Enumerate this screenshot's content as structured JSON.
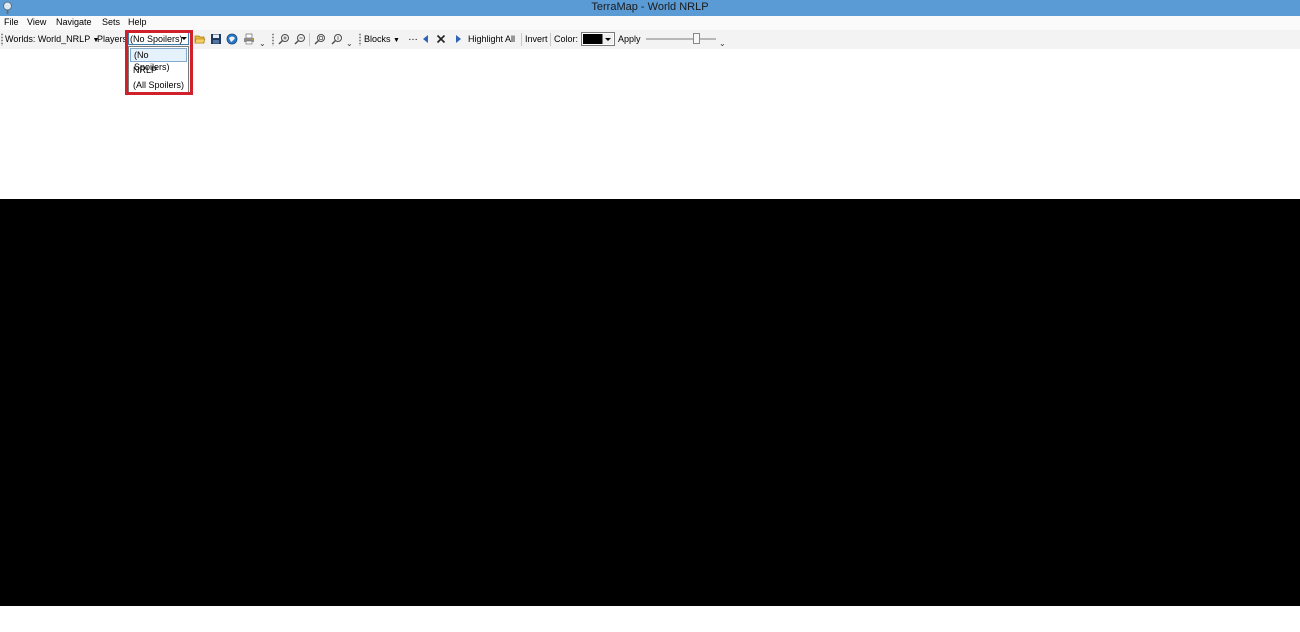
{
  "window": {
    "title": "TerraMap - World NRLP"
  },
  "menu": [
    "File",
    "View",
    "Navigate",
    "Sets",
    "Help"
  ],
  "toolbar": {
    "worlds_label": "Worlds: World_NRLP",
    "players_label": "Players",
    "spoilers": {
      "selected": "(No Spoilers)",
      "options": [
        "(No Spoilers)",
        "NRLP",
        "(All Spoilers)"
      ]
    },
    "blocks_label": "Blocks",
    "highlight_all_label": "Highlight All",
    "invert_label": "Invert",
    "color_label": "Color:",
    "highlight_color": "#000000",
    "apply_label": "Apply",
    "overflow_glyph": "⌄"
  },
  "colors": {
    "titlebar": "#5b9bd5",
    "highlight_box": "#d0202b",
    "map_background": "#000000"
  }
}
